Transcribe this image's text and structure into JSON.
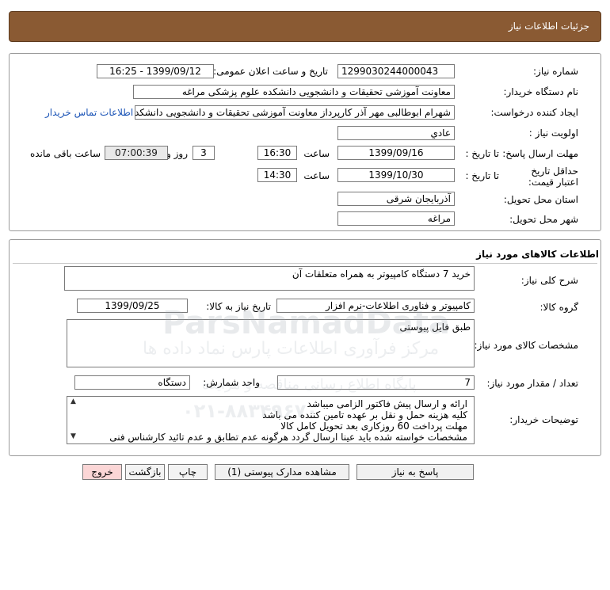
{
  "header": {
    "title": "جزئیات اطلاعات نیاز"
  },
  "need_info": {
    "need_number_label": "شماره نیاز:",
    "need_number": "1299030244000043",
    "announce_label": "تاریخ و ساعت اعلان عمومی:",
    "announce_value": "1399/09/12 - 16:25",
    "buyer_org_label": "نام دستگاه خریدار:",
    "buyer_org": "معاونت آموزشی تحقیقات و دانشجویی دانشکده علوم پزشکی مراغه",
    "creator_label": "ایجاد کننده درخواست:",
    "creator": "شهرام ابوطالبی مهر آذر کارپرداز معاونت آموزشی تحقیقات و دانشجویی دانشکده",
    "contact_link": "اطلاعات تماس خریدار",
    "priority_label": "اولویت نیاز :",
    "priority": "عادي",
    "reply_deadline_label": "مهلت ارسال پاسخ:",
    "to_date_label": "تا تاریخ :",
    "reply_date": "1399/09/16",
    "time_label": "ساعت",
    "reply_time": "16:30",
    "days": "3",
    "days_label": "روز و",
    "remaining_time": "07:00:39",
    "remaining_label": "ساعت باقی مانده",
    "min_validity_label": "حداقل تاریخ اعتبار قیمت:",
    "validity_to_label": "تا تاریخ :",
    "validity_date": "1399/10/30",
    "validity_time_label": "ساعت",
    "validity_time": "14:30",
    "province_label": "استان محل تحویل:",
    "province": "آذربایجان شرقی",
    "city_label": "شهر محل تحویل:",
    "city": "مراغه"
  },
  "goods": {
    "section_title": "اطلاعات کالاهای مورد نیاز",
    "summary_label": "شرح کلی نیاز:",
    "summary": "خرید 7 دستگاه کامپیوتر به همراه متعلقات آن",
    "group_label": "گروه کالا:",
    "group": "کامپیوتر و فناوری اطلاعات-نرم افزار",
    "need_date_label": "تاریخ نیاز به کالا:",
    "need_date": "1399/09/25",
    "specs_label": "مشخصات کالای مورد نیاز:",
    "specs": "طبق فایل پیوستی",
    "qty_label": "تعداد / مقدار مورد نیاز:",
    "qty": "7",
    "unit_label": "واحد شمارش:",
    "unit": "دستگاه",
    "notes_label": "توضیحات خریدار:",
    "notes": [
      "ارائه و ارسال پیش فاکتور الزامی میباشد",
      "کلیه هزینه حمل و نقل  بر عهده تامین کننده می باشد",
      "مهلت پرداخت  60 روزکاری بعد تحویل کامل کالا",
      "مشخصات خواسته شده باید عینا ارسال گردد هرگونه عدم تطابق و عدم تائید کارشناس فنی"
    ]
  },
  "buttons": {
    "reply": "پاسخ به نیاز",
    "attachments": "مشاهده مدارک پیوستی (1)",
    "print": "چاپ",
    "back": "بازگشت",
    "exit": "خروج"
  },
  "watermark": {
    "brand": "ParsNamadData",
    "line1": "مرکز فرآوری اطلاعات پارس نماد داده ها",
    "line2": "پایگاه اطلاع رسانی مناقصه و مزایده",
    "phone": "۰۲۱-۸۸۳۴۹۶۷۰"
  }
}
